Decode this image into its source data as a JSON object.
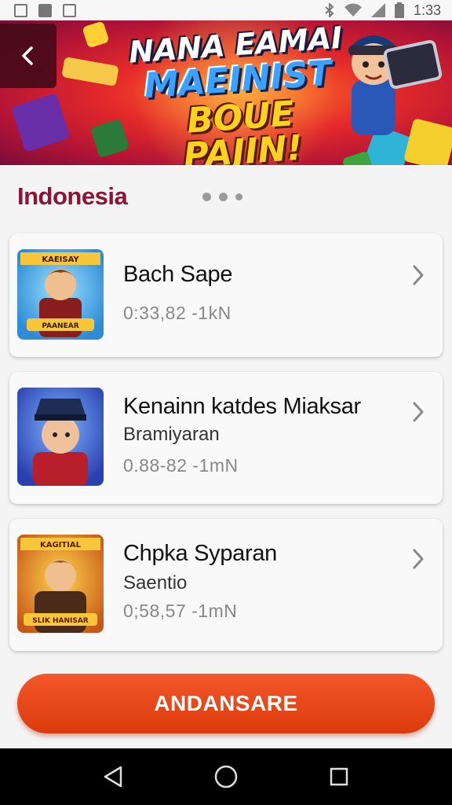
{
  "status_bar": {
    "time": "1:33",
    "left_icons": [
      "image-icon",
      "download-icon",
      "notification-icon"
    ],
    "right_icons": [
      "bluetooth-icon",
      "wifi-icon",
      "signal-icon",
      "battery-icon"
    ]
  },
  "banner": {
    "line1": "NANA EAMAI",
    "line2": "MAEINIST",
    "line3": "BOUE PAJIN!"
  },
  "section": {
    "title": "Indonesia"
  },
  "items": [
    {
      "title": "Bach Sape",
      "subtitle": "",
      "meta": "0:33,82 -1kN",
      "thumb_text": "KAEISAY",
      "thumb_caption": "PAANEAR"
    },
    {
      "title": "Kenainn katdes Miaksar",
      "subtitle": "Bramiyaran",
      "meta": "0.88-82 -1mN",
      "thumb_text": "",
      "thumb_caption": ""
    },
    {
      "title": "Chpka Syparan",
      "subtitle": "Saentio",
      "meta": "0;58,57 -1mN",
      "thumb_text": "KAGITIAL",
      "thumb_caption": "SLIK HANISAR"
    }
  ],
  "cta": {
    "label": "ANDANSARE"
  },
  "colors": {
    "accent": "#e8471a",
    "section_title": "#8a1535",
    "banner_red": "#d62630"
  }
}
